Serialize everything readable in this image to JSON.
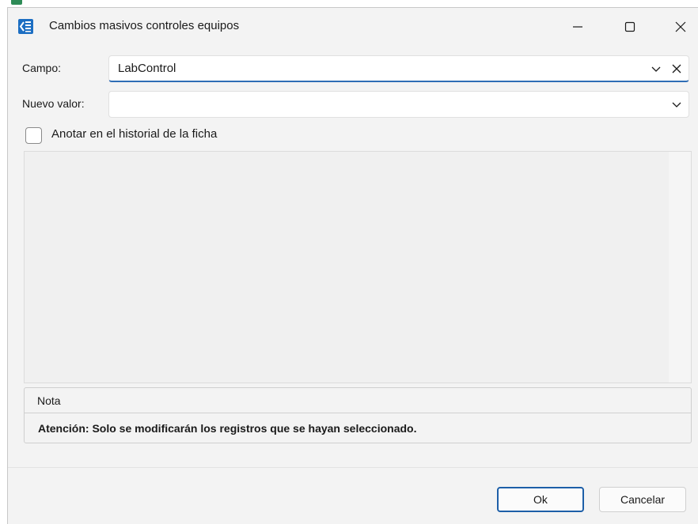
{
  "window": {
    "title": "Cambios masivos controles equipos",
    "controls": {
      "minimize": "minimize-icon",
      "maximize": "maximize-icon",
      "close": "close-icon"
    }
  },
  "form": {
    "campo_label": "Campo:",
    "campo_value": "LabControl",
    "nuevo_valor_label": "Nuevo valor:",
    "nuevo_valor_value": "",
    "anotar_checkbox_label": "Anotar en el historial de la ficha",
    "anotar_checked": false
  },
  "note": {
    "title": "Nota",
    "text": "Atención: Solo se modificarán los registros que se hayan seleccionado."
  },
  "buttons": {
    "ok": "Ok",
    "cancel": "Cancelar"
  },
  "colors": {
    "accent": "#1d5fa8",
    "dialog_bg": "#f3f3f3",
    "app_icon": "#1c6ec2"
  }
}
